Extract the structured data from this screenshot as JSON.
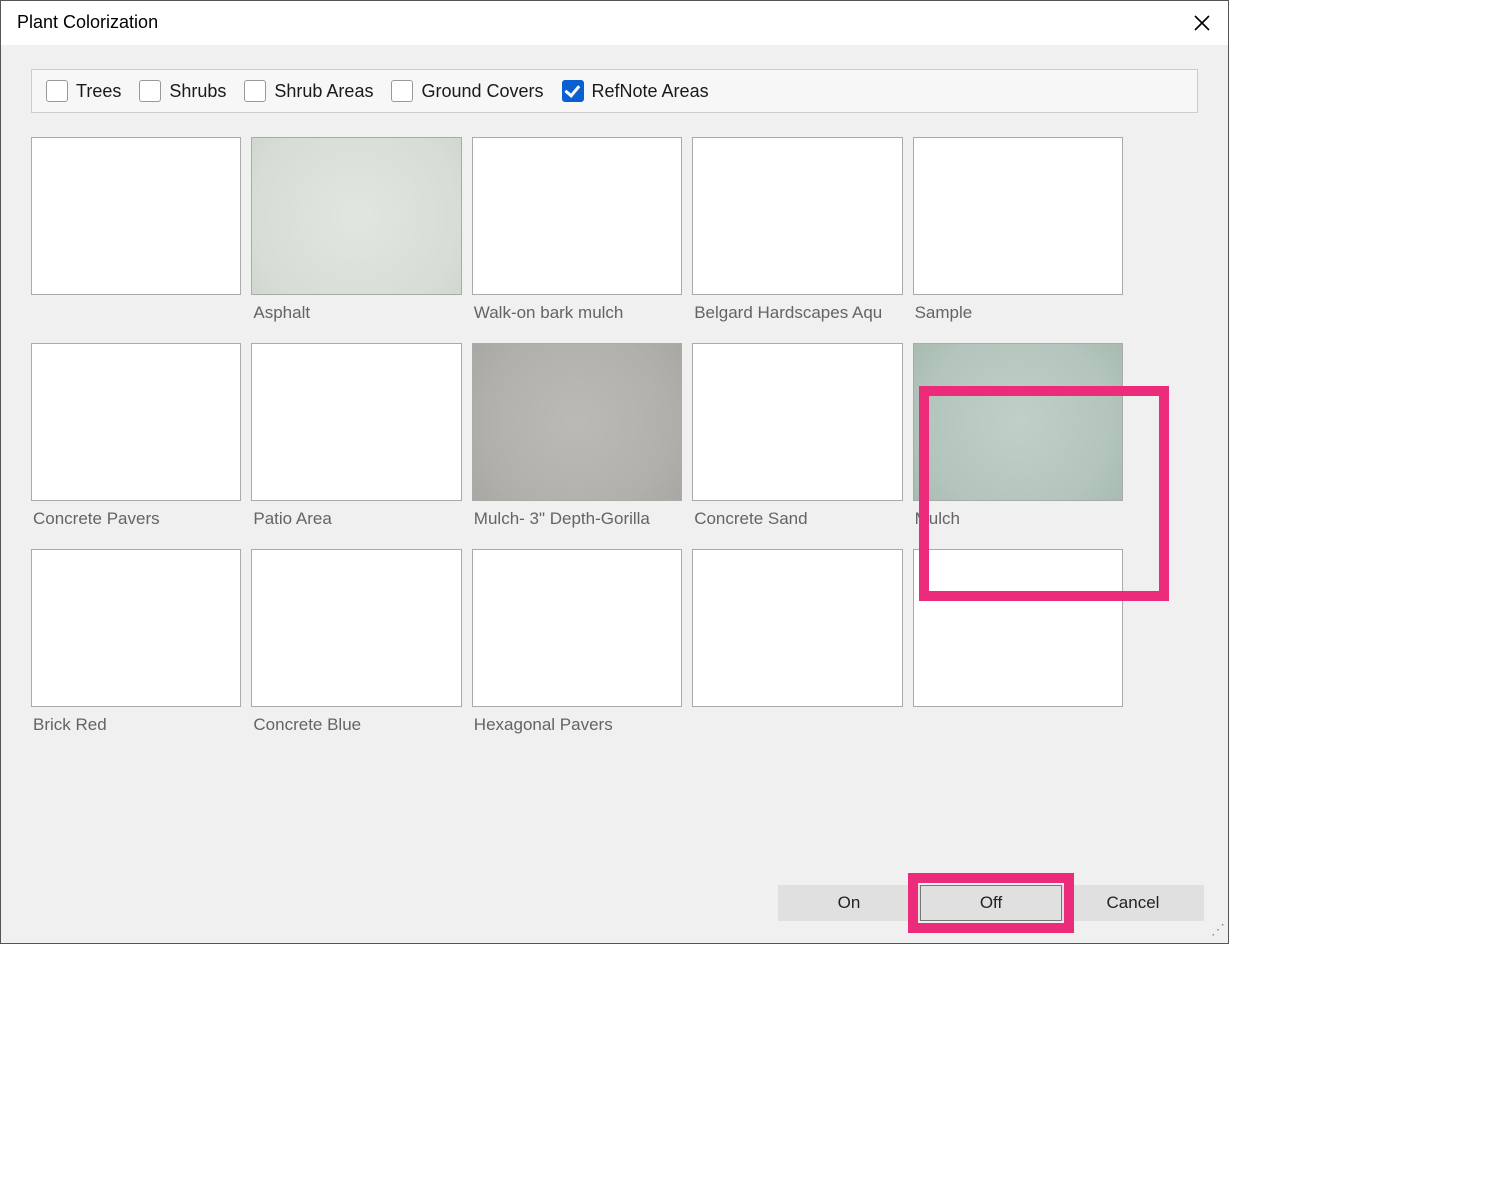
{
  "dialog": {
    "title": "Plant Colorization"
  },
  "filters": {
    "trees": {
      "label": "Trees",
      "checked": false
    },
    "shrubs": {
      "label": "Shrubs",
      "checked": false
    },
    "shrub_areas": {
      "label": "Shrub Areas",
      "checked": false
    },
    "ground_covers": {
      "label": "Ground Covers",
      "checked": false
    },
    "refnote_areas": {
      "label": "RefNote Areas",
      "checked": true
    }
  },
  "swatches": [
    {
      "label": "",
      "style": ""
    },
    {
      "label": "Asphalt",
      "style": "asphalt"
    },
    {
      "label": "Walk-on bark mulch",
      "style": ""
    },
    {
      "label": "Belgard Hardscapes Aqu",
      "style": ""
    },
    {
      "label": "Sample",
      "style": ""
    },
    {
      "label": "Concrete Pavers",
      "style": ""
    },
    {
      "label": "Patio Area",
      "style": ""
    },
    {
      "label": "Mulch- 3\" Depth-Gorilla",
      "style": "mulchd"
    },
    {
      "label": "Concrete Sand",
      "style": ""
    },
    {
      "label": "Mulch",
      "style": "mulch2"
    },
    {
      "label": "Brick Red",
      "style": ""
    },
    {
      "label": "Concrete Blue",
      "style": ""
    },
    {
      "label": "Hexagonal Pavers",
      "style": ""
    },
    {
      "label": "",
      "style": ""
    },
    {
      "label": "",
      "style": ""
    }
  ],
  "buttons": {
    "on": "On",
    "off": "Off",
    "cancel": "Cancel"
  },
  "highlights": {
    "swatch_index": 9,
    "button": "off"
  }
}
